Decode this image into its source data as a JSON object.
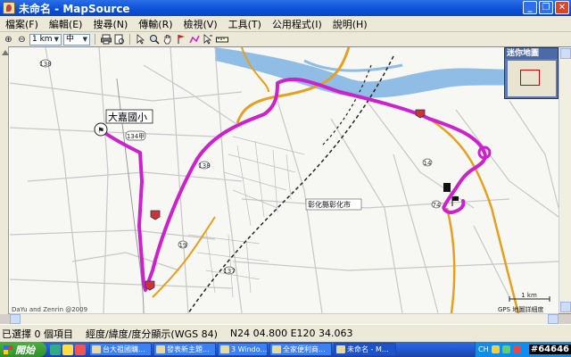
{
  "window": {
    "title": "未命名 - MapSource",
    "min_glyph": "_",
    "max_glyph": "❐",
    "close_glyph": "✕"
  },
  "menu": [
    "檔案(F)",
    "編輯(E)",
    "搜尋(N)",
    "傳輸(R)",
    "檢視(V)",
    "工具(T)",
    "公用程式(I)",
    "說明(H)"
  ],
  "toolbar": {
    "zoom_in": "⊕",
    "zoom_out": "⊖",
    "scale_value": "1 km",
    "detail_value": "中"
  },
  "map": {
    "labels": {
      "school": "大嘉國小",
      "city": "彰化縣彰化市",
      "route_134": "134甲",
      "route_138": "138",
      "route_19": "19",
      "route_137": "137",
      "route_74": "74",
      "route_1": "1",
      "route_14": "14",
      "copyright": "DaYu and Zenrin @2009",
      "scale": "1 km",
      "datum": "GPS 地圖詳細度"
    },
    "minimap_title": "迷你地圖"
  },
  "status": {
    "selected": "已選擇 0 個項目",
    "format": "經度/緯度/度分顯示(WGS 84)",
    "coords": "N24 04.800 E120 34.063"
  },
  "taskbar": {
    "start_label": "開始",
    "tasks": [
      "台大祖國購...",
      "發表新主題...",
      "3 Windo...",
      "全家便利商...",
      "未命名 - M..."
    ],
    "tray_lang": "CH",
    "clock": "#64646"
  },
  "colors": {
    "route": "#cc22cc",
    "highway": "#e6a020",
    "river": "#6aa6d8"
  }
}
